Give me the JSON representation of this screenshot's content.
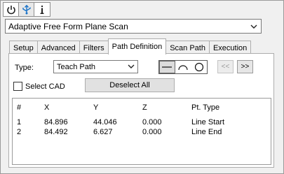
{
  "toolbar": {
    "icons": [
      "power-icon",
      "usb-icon",
      "info-icon"
    ]
  },
  "scan_select": {
    "value": "Adaptive Free Form Plane Scan"
  },
  "tabs": [
    {
      "label": "Setup"
    },
    {
      "label": "Advanced"
    },
    {
      "label": "Filters"
    },
    {
      "label": "Path Definition",
      "active": true
    },
    {
      "label": "Scan Path"
    },
    {
      "label": "Execution"
    }
  ],
  "path_definition": {
    "type_label": "Type:",
    "type_value": "Teach Path",
    "prev_label": "<<",
    "next_label": ">>",
    "select_cad_label": "Select CAD",
    "deselect_all_label": "Deselect All",
    "table": {
      "headers": [
        "#",
        "X",
        "Y",
        "Z",
        "Pt. Type"
      ],
      "rows": [
        [
          "1",
          "84.896",
          "44.046",
          "0.000",
          "Line Start"
        ],
        [
          "2",
          "84.492",
          "6.627",
          "0.000",
          "Line End"
        ]
      ]
    }
  }
}
